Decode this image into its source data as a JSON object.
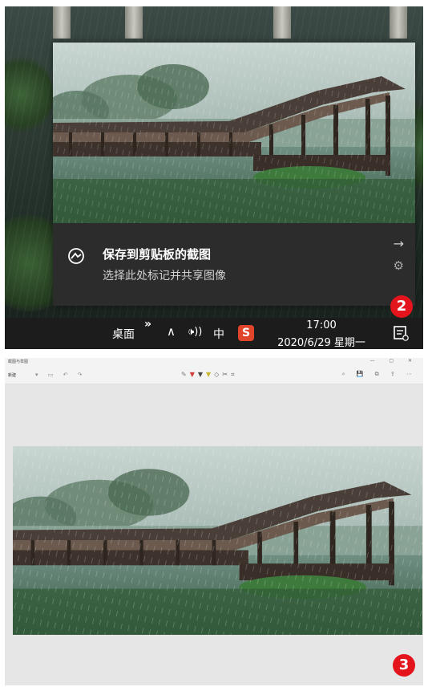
{
  "toast": {
    "title": "保存到剪贴板的截图",
    "subtitle": "选择此处标记并共享图像",
    "arrow": "→",
    "gear": "⚙"
  },
  "taskbar": {
    "desktop_label": "桌面",
    "chevron": "»",
    "tray_up": "∧",
    "volume": "🕩))",
    "ime": "中",
    "sogou": "S",
    "time": "17:00",
    "date": "2020/6/29 星期一"
  },
  "badges": {
    "step2": "2",
    "step3": "3"
  },
  "snip_window": {
    "title": "截图与草图",
    "new_label": "新建",
    "controls": "— ▢ ✕"
  },
  "colors": {
    "badge": "#e3141b",
    "toast_bg": "#2b2b2b",
    "taskbar_bg": "#1c1c1c"
  }
}
